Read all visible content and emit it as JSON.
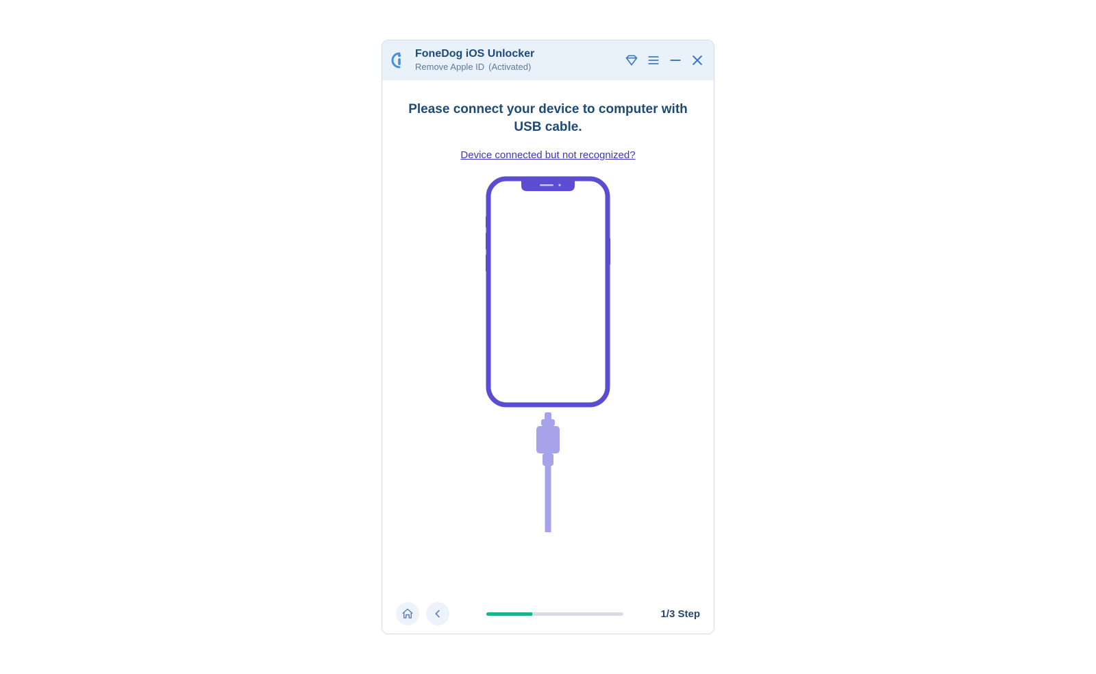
{
  "header": {
    "app_title": "FoneDog iOS Unlocker",
    "subtitle": "Remove Apple ID",
    "activated": "(Activated)"
  },
  "main": {
    "instruction": "Please connect your device to computer with USB cable.",
    "help_link": "Device connected but not recognized?"
  },
  "footer": {
    "step_label": "1/3 Step",
    "progress_percent": 33.33
  },
  "colors": {
    "accent_blue": "#3a7cc2",
    "heading_blue": "#1e4a77",
    "link_purple": "#3a37c0",
    "device_purple": "#5a4dd0",
    "cable_light": "#a6a3ea",
    "progress_green": "#1cb28c"
  }
}
